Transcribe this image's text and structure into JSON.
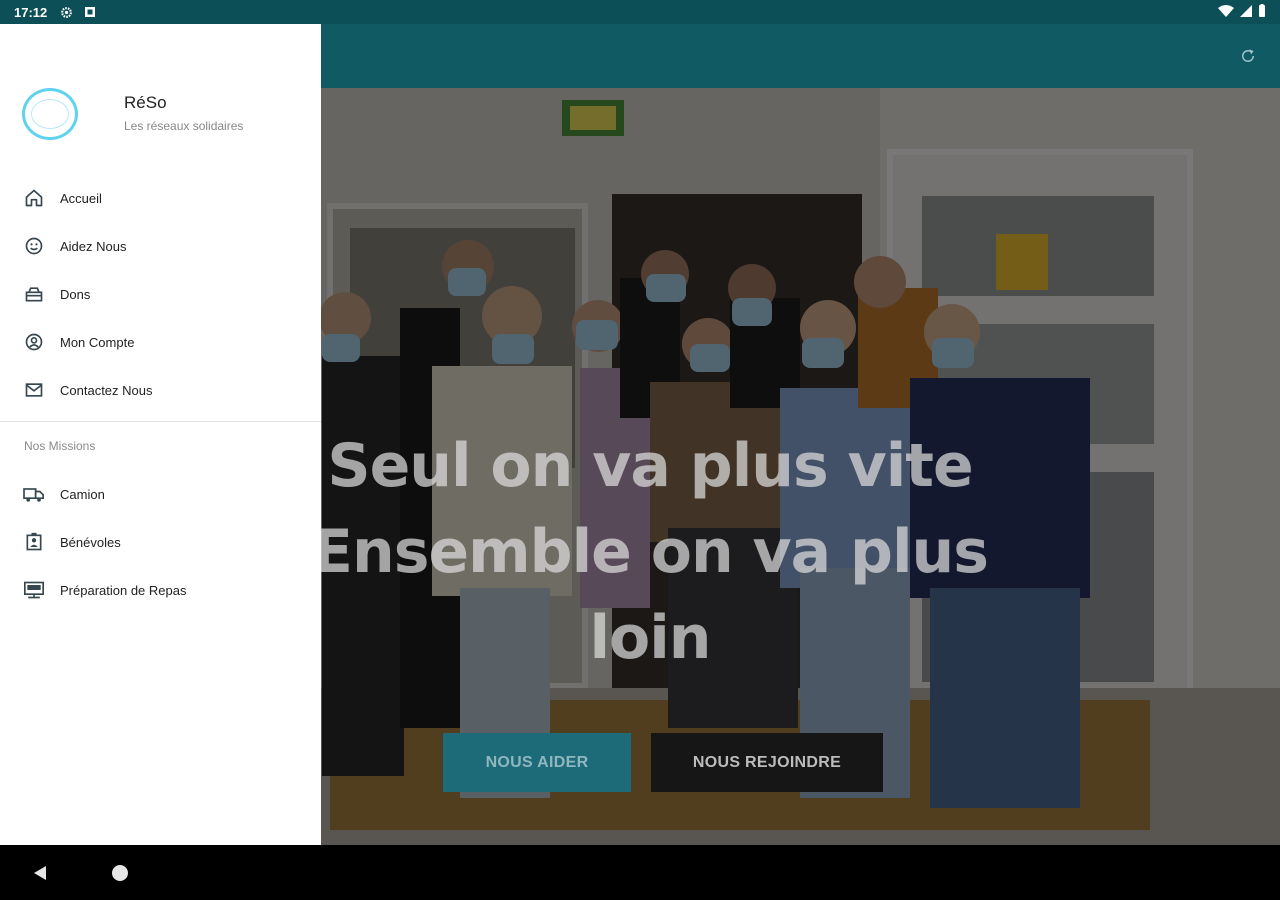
{
  "status_bar": {
    "time": "17:12"
  },
  "drawer": {
    "app_name": "RéSo",
    "app_subtitle": "Les réseaux solidaires",
    "menu_items": [
      {
        "label": "Accueil",
        "icon": "home-icon"
      },
      {
        "label": "Aidez Nous",
        "icon": "smiley-icon"
      },
      {
        "label": "Dons",
        "icon": "donation-box-icon"
      },
      {
        "label": "Mon Compte",
        "icon": "account-icon"
      },
      {
        "label": "Contactez Nous",
        "icon": "mail-icon"
      }
    ],
    "section_title": "Nos Missions",
    "mission_items": [
      {
        "label": "Camion",
        "icon": "truck-icon"
      },
      {
        "label": "Bénévoles",
        "icon": "volunteer-badge-icon"
      },
      {
        "label": "Préparation de Repas",
        "icon": "meal-prep-icon"
      }
    ]
  },
  "hero": {
    "headline": "Seul on va plus vite Ensemble on va plus loin",
    "help_button": "NOUS AIDER",
    "join_button": "NOUS REJOINDRE"
  },
  "colors": {
    "status_bar": "#0c4f57",
    "app_bar": "#0f5a63",
    "help_button": "#1d6a78",
    "join_button": "#161616",
    "logo_ring": "#5fd3ee"
  }
}
